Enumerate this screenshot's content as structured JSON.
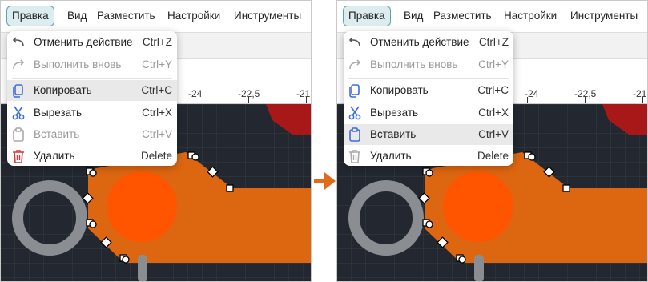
{
  "menubar": {
    "items": [
      "Правка",
      "Вид",
      "Разместить",
      "Настройки",
      "Инструменты"
    ]
  },
  "ruler": {
    "labels": [
      "-24",
      "-22,5",
      "-21"
    ]
  },
  "menu": {
    "items": [
      {
        "label": "Отменить действие",
        "shortcut": "Ctrl+Z",
        "icon": "undo-icon"
      },
      {
        "label": "Выполнить вновь",
        "shortcut": "Ctrl+Y",
        "icon": "redo-icon"
      },
      {
        "label": "Копировать",
        "shortcut": "Ctrl+C",
        "icon": "copy-icon"
      },
      {
        "label": "Вырезать",
        "shortcut": "Ctrl+X",
        "icon": "scissors-icon"
      },
      {
        "label": "Вставить",
        "shortcut": "Ctrl+V",
        "icon": "clipboard-icon"
      },
      {
        "label": "Удалить",
        "shortcut": "Delete",
        "icon": "trash-icon"
      }
    ]
  },
  "panels": {
    "left": {
      "highlighted": "Копировать",
      "disabled": [
        "Выполнить вновь",
        "Вставить"
      ]
    },
    "right": {
      "highlighted": "Вставить",
      "disabled": [
        "Выполнить вновь"
      ]
    }
  },
  "colors": {
    "accent": "#59a5aa",
    "copper": "#dd6610",
    "pad": "#ff5500",
    "canvas": "#232830",
    "icon_blue": "#3f6de0",
    "delete_red": "#d43a3a",
    "arrow": "#e06b1a"
  }
}
